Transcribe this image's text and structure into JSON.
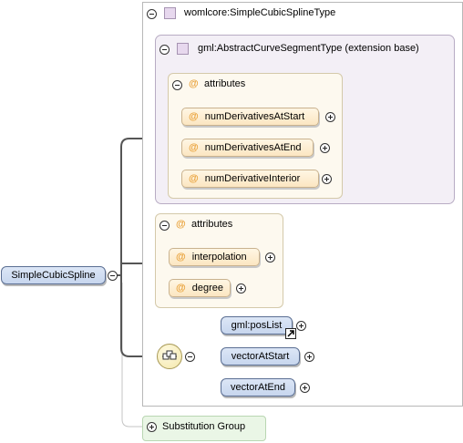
{
  "root": {
    "label": "SimpleCubicSpline"
  },
  "type_box": {
    "title": "womlcore:SimpleCubicSplineType"
  },
  "extension_box": {
    "title": "gml:AbstractCurveSegmentType (extension base)"
  },
  "ext_attributes": {
    "header": "attributes",
    "items": [
      "numDerivativesAtStart",
      "numDerivativesAtEnd",
      "numDerivativeInterior"
    ]
  },
  "own_attributes": {
    "header": "attributes",
    "items": [
      "interpolation",
      "degree"
    ]
  },
  "sequence": {
    "items": [
      "gml:posList",
      "vectorAtStart",
      "vectorAtEnd"
    ]
  },
  "substitution": {
    "label": "Substitution Group"
  },
  "icons": {
    "at_symbol": "@",
    "colors": {
      "element": "#c7d6ee",
      "attribute": "#fbe6c1",
      "extension": "#f3eff6",
      "substitution": "#eaf6e6"
    }
  }
}
